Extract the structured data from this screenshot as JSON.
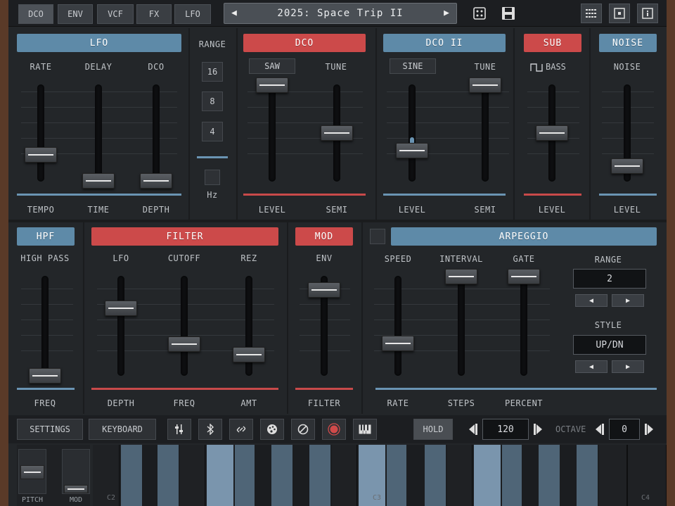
{
  "top": {
    "tabs": [
      "DCO",
      "ENV",
      "VCF",
      "FX",
      "LFO"
    ],
    "active_tab": "DCO",
    "preset_name": "2025: Space Trip II",
    "prev_arrow": "◀",
    "next_arrow": "▶",
    "icons": [
      "dice-icon",
      "save-icon",
      "grid-icon",
      "window-icon",
      "info-icon"
    ]
  },
  "lfo": {
    "title": "LFO",
    "labels": [
      "RATE",
      "DELAY",
      "DCO"
    ],
    "bottom_labels": [
      "TEMPO",
      "TIME",
      "DEPTH"
    ],
    "values": [
      0.3,
      0.0,
      0.0
    ]
  },
  "range": {
    "label": "RANGE",
    "options": [
      "16",
      "8",
      "4"
    ],
    "hz_label": "Hz"
  },
  "dco": {
    "title": "DCO",
    "wave": "SAW",
    "tune_label": "TUNE",
    "bottom_labels": [
      "LEVEL",
      "SEMI"
    ],
    "values": [
      1.0,
      0.5
    ]
  },
  "dco2": {
    "title": "DCO II",
    "wave": "SINE",
    "tune_label": "TUNE",
    "bottom_labels": [
      "LEVEL",
      "SEMI"
    ],
    "values": [
      0.32,
      1.0
    ]
  },
  "sub": {
    "title": "SUB",
    "label": "BASS",
    "bottom_label": "LEVEL",
    "value": 0.5
  },
  "noise": {
    "title": "NOISE",
    "label": "NOISE",
    "bottom_label": "LEVEL",
    "value": 0.15
  },
  "hpf": {
    "title": "HPF",
    "label": "HIGH PASS",
    "bottom_label": "FREQ",
    "value": 0.0
  },
  "filter": {
    "title": "FILTER",
    "labels": [
      "LFO",
      "CUTOFF",
      "REZ"
    ],
    "bottom_labels": [
      "DEPTH",
      "FREQ",
      "AMT"
    ],
    "values": [
      0.7,
      0.3,
      0.2
    ]
  },
  "mod": {
    "title": "MOD",
    "label": "ENV",
    "bottom_label": "FILTER",
    "value": 0.9
  },
  "arp": {
    "title": "ARPEGGIO",
    "labels": [
      "SPEED",
      "INTERVAL",
      "GATE"
    ],
    "bottom_labels": [
      "RATE",
      "STEPS",
      "PERCENT"
    ],
    "values": [
      0.3,
      1.0,
      1.0
    ],
    "range_label": "RANGE",
    "range_value": "2",
    "style_label": "STYLE",
    "style_value": "UP/DN"
  },
  "bottom": {
    "settings": "SETTINGS",
    "keyboard": "KEYBOARD",
    "hold": "HOLD",
    "tempo": "120",
    "octave_label": "OCTAVE",
    "octave": "0"
  },
  "keyboard": {
    "pitch_label": "PITCH",
    "mod_label": "MOD",
    "note_labels": [
      "C2",
      "C3",
      "C4"
    ],
    "pitch_value": 0.5,
    "mod_value": 0.0
  }
}
